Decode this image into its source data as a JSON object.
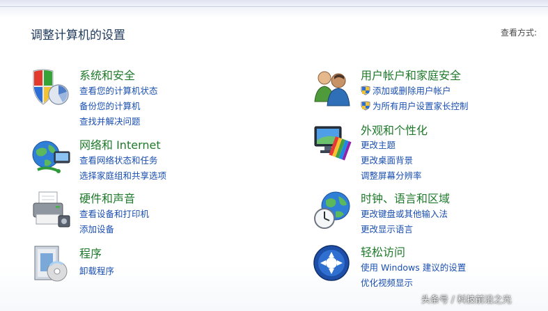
{
  "header": {
    "title": "调整计算机的设置",
    "view_by_label": "查看方式:"
  },
  "categories": [
    {
      "title": "系统和安全",
      "icon": "shield-pie-icon",
      "links": [
        "查看您的计算机状态",
        "备份您的计算机",
        "查找并解决问题"
      ]
    },
    {
      "title": "网络和 Internet",
      "icon": "network-globe-icon",
      "links": [
        "查看网络状态和任务",
        "选择家庭组和共享选项"
      ]
    },
    {
      "title": "硬件和声音",
      "icon": "printer-icon",
      "links": [
        "查看设备和打印机",
        "添加设备"
      ]
    },
    {
      "title": "程序",
      "icon": "programs-box-icon",
      "links": [
        "卸载程序"
      ]
    },
    {
      "title": "用户帐户和家庭安全",
      "icon": "users-icon",
      "links": [
        "添加或删除用户帐户",
        "为所有用户设置家长控制"
      ]
    },
    {
      "title": "外观和个性化",
      "icon": "monitor-palette-icon",
      "links": [
        "更改主题",
        "更改桌面背景",
        "调整屏幕分辨率"
      ]
    },
    {
      "title": "时钟、语言和区域",
      "icon": "globe-clock-icon",
      "links": [
        "更改键盘或其他输入法",
        "更改显示语言"
      ]
    },
    {
      "title": "轻松访问",
      "icon": "ease-of-access-icon",
      "links": [
        "使用 Windows 建议的设置",
        "优化视频显示"
      ]
    }
  ],
  "watermark": "头条号 / 科技前沿之光",
  "colors": {
    "category_title": "#1e7a2a",
    "link": "#1a4fb0",
    "page_title": "#1e395b"
  }
}
